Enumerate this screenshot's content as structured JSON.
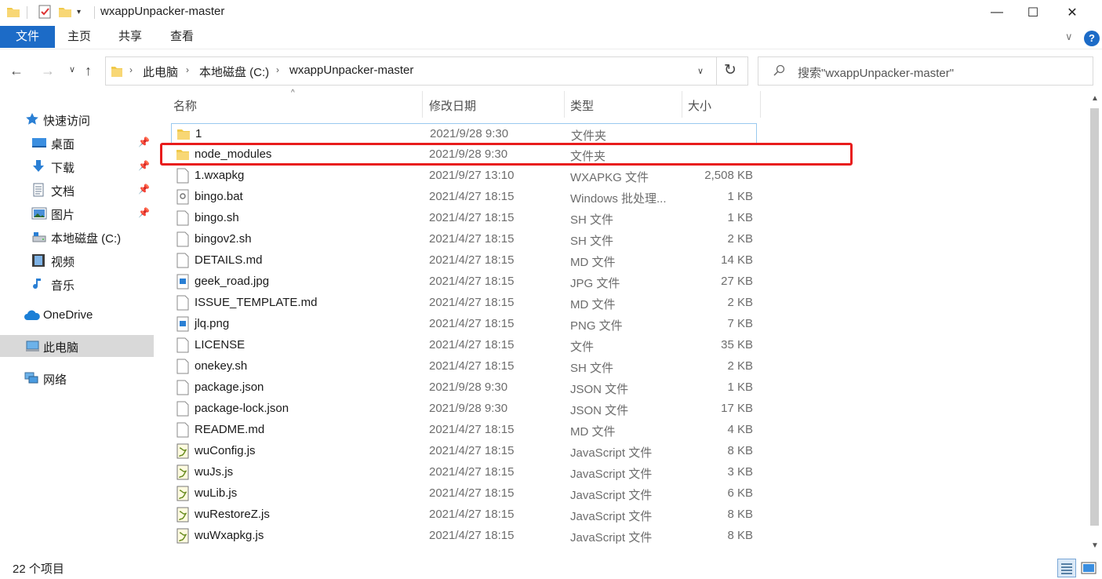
{
  "window": {
    "title": "wxappUnpacker-master",
    "minimize_glyph": "—",
    "maximize_glyph": "☐",
    "close_glyph": "✕"
  },
  "ribbon": {
    "tabs": [
      "文件",
      "主页",
      "共享",
      "查看"
    ],
    "help_glyph": "?",
    "expand_glyph": "∨"
  },
  "address": {
    "crumbs": [
      "此电脑",
      "本地磁盘 (C:)",
      "wxappUnpacker-master"
    ],
    "separator": "›",
    "refresh_glyph": "↻"
  },
  "search": {
    "placeholder": "搜索\"wxappUnpacker-master\""
  },
  "sidebar": {
    "items": [
      {
        "label": "快速访问",
        "icon": "star-icon",
        "pinned": false
      },
      {
        "label": "桌面",
        "icon": "desktop-icon",
        "pinned": true
      },
      {
        "label": "下载",
        "icon": "download-icon",
        "pinned": true
      },
      {
        "label": "文档",
        "icon": "document-icon",
        "pinned": true
      },
      {
        "label": "图片",
        "icon": "pictures-icon",
        "pinned": true
      },
      {
        "label": "本地磁盘 (C:)",
        "icon": "drive-icon",
        "pinned": false
      },
      {
        "label": "视频",
        "icon": "video-icon",
        "pinned": false
      },
      {
        "label": "音乐",
        "icon": "music-icon",
        "pinned": false
      },
      {
        "label": "OneDrive",
        "icon": "cloud-icon",
        "pinned": false
      },
      {
        "label": "此电脑",
        "icon": "computer-icon",
        "pinned": false
      },
      {
        "label": "网络",
        "icon": "network-icon",
        "pinned": false
      }
    ],
    "active_index": 9
  },
  "columns": {
    "name": "名称",
    "date": "修改日期",
    "type": "类型",
    "size": "大小"
  },
  "files": [
    {
      "name": "1",
      "date": "2021/9/28 9:30",
      "type": "文件夹",
      "size": "",
      "icon": "folder-icon"
    },
    {
      "name": "node_modules",
      "date": "2021/9/28 9:30",
      "type": "文件夹",
      "size": "",
      "icon": "folder-icon"
    },
    {
      "name": "1.wxapkg",
      "date": "2021/9/27 13:10",
      "type": "WXAPKG 文件",
      "size": "2,508 KB",
      "icon": "file-icon"
    },
    {
      "name": "bingo.bat",
      "date": "2021/4/27 18:15",
      "type": "Windows 批处理...",
      "size": "1 KB",
      "icon": "batch-file-icon"
    },
    {
      "name": "bingo.sh",
      "date": "2021/4/27 18:15",
      "type": "SH 文件",
      "size": "1 KB",
      "icon": "file-icon"
    },
    {
      "name": "bingov2.sh",
      "date": "2021/4/27 18:15",
      "type": "SH 文件",
      "size": "2 KB",
      "icon": "file-icon"
    },
    {
      "name": "DETAILS.md",
      "date": "2021/4/27 18:15",
      "type": "MD 文件",
      "size": "14 KB",
      "icon": "file-icon"
    },
    {
      "name": "geek_road.jpg",
      "date": "2021/4/27 18:15",
      "type": "JPG 文件",
      "size": "27 KB",
      "icon": "image-file-icon"
    },
    {
      "name": "ISSUE_TEMPLATE.md",
      "date": "2021/4/27 18:15",
      "type": "MD 文件",
      "size": "2 KB",
      "icon": "file-icon"
    },
    {
      "name": "jlq.png",
      "date": "2021/4/27 18:15",
      "type": "PNG 文件",
      "size": "7 KB",
      "icon": "image-file-icon"
    },
    {
      "name": "LICENSE",
      "date": "2021/4/27 18:15",
      "type": "文件",
      "size": "35 KB",
      "icon": "file-icon"
    },
    {
      "name": "onekey.sh",
      "date": "2021/4/27 18:15",
      "type": "SH 文件",
      "size": "2 KB",
      "icon": "file-icon"
    },
    {
      "name": "package.json",
      "date": "2021/9/28 9:30",
      "type": "JSON 文件",
      "size": "1 KB",
      "icon": "file-icon"
    },
    {
      "name": "package-lock.json",
      "date": "2021/9/28 9:30",
      "type": "JSON 文件",
      "size": "17 KB",
      "icon": "file-icon"
    },
    {
      "name": "README.md",
      "date": "2021/4/27 18:15",
      "type": "MD 文件",
      "size": "4 KB",
      "icon": "file-icon"
    },
    {
      "name": "wuConfig.js",
      "date": "2021/4/27 18:15",
      "type": "JavaScript 文件",
      "size": "8 KB",
      "icon": "js-file-icon"
    },
    {
      "name": "wuJs.js",
      "date": "2021/4/27 18:15",
      "type": "JavaScript 文件",
      "size": "3 KB",
      "icon": "js-file-icon"
    },
    {
      "name": "wuLib.js",
      "date": "2021/4/27 18:15",
      "type": "JavaScript 文件",
      "size": "6 KB",
      "icon": "js-file-icon"
    },
    {
      "name": "wuRestoreZ.js",
      "date": "2021/4/27 18:15",
      "type": "JavaScript 文件",
      "size": "8 KB",
      "icon": "js-file-icon"
    },
    {
      "name": "wuWxapkg.js",
      "date": "2021/4/27 18:15",
      "type": "JavaScript 文件",
      "size": "8 KB",
      "icon": "js-file-icon"
    }
  ],
  "highlighted_file": "node_modules",
  "status": {
    "item_count": "22 个项目"
  },
  "colors": {
    "accent": "#1c6bc7",
    "highlight_box": "#e81c1c",
    "folder": "#f0c94a"
  }
}
